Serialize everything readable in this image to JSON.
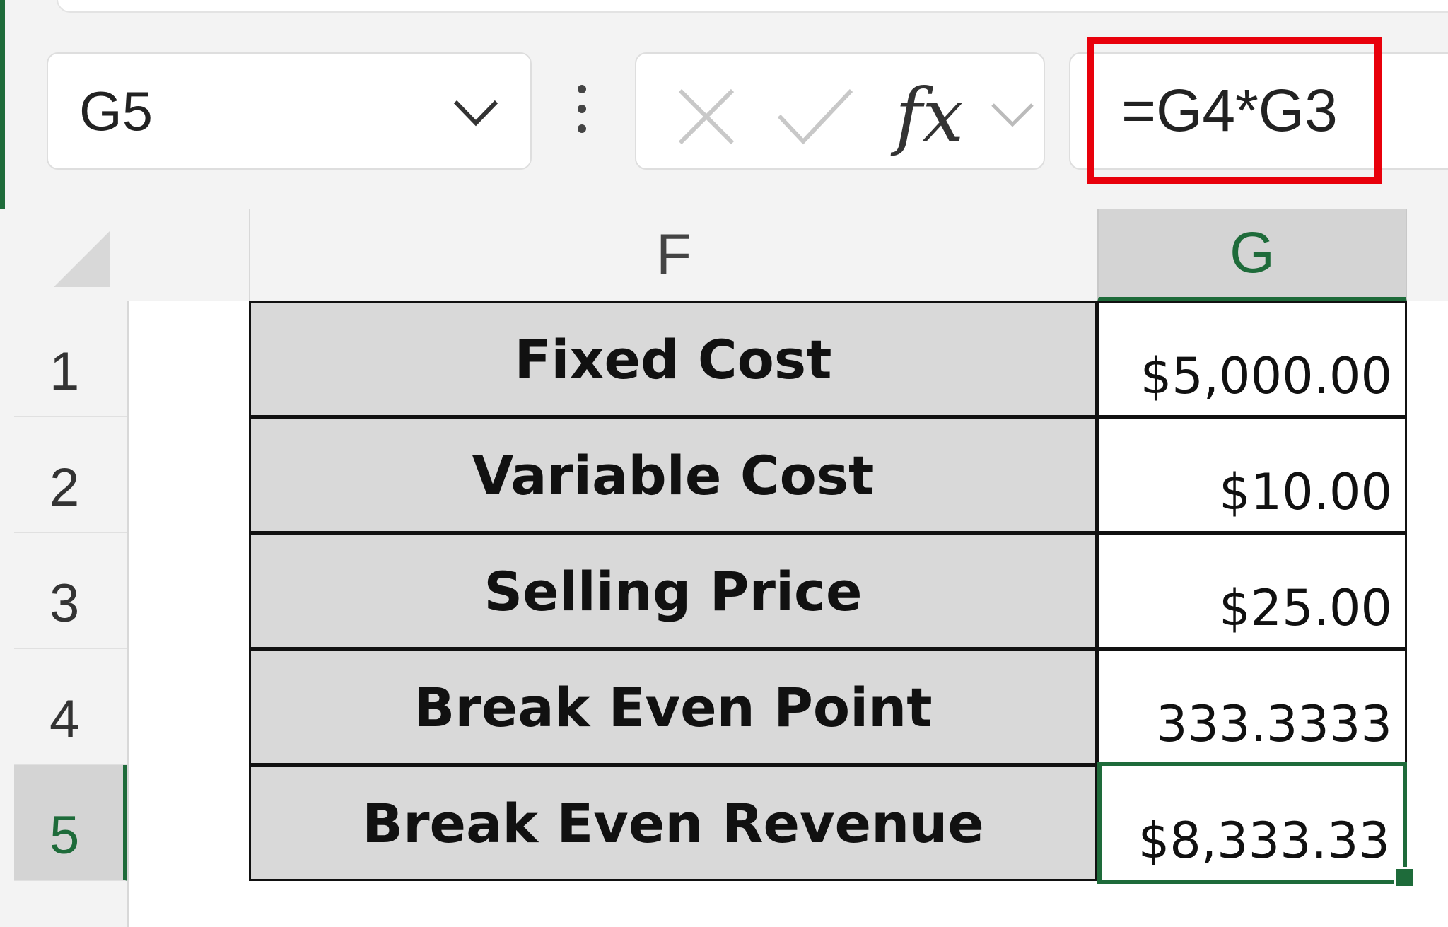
{
  "name_box": {
    "value": "G5"
  },
  "formula_bar": {
    "formula": "=G4*G3",
    "fx_label": "fx"
  },
  "highlight_color": "#e8000b",
  "accent_color": "#1e6b3a",
  "columns": [
    {
      "label": "F"
    },
    {
      "label": "G"
    }
  ],
  "rows": [
    {
      "num": "1",
      "label": "Fixed Cost",
      "value": "$5,000.00"
    },
    {
      "num": "2",
      "label": "Variable Cost",
      "value": "$10.00"
    },
    {
      "num": "3",
      "label": "Selling Price",
      "value": "$25.00"
    },
    {
      "num": "4",
      "label": "Break Even Point",
      "value": "333.3333"
    },
    {
      "num": "5",
      "label": "Break Even Revenue",
      "value": "$8,333.33"
    }
  ],
  "active_cell": "G5"
}
